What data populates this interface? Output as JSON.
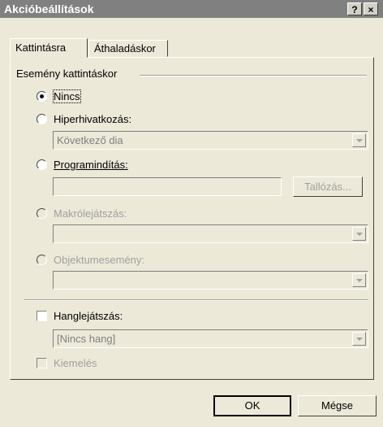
{
  "window": {
    "title": "Akcióbeállítások",
    "help_label": "?",
    "close_label": "×"
  },
  "tabs": [
    {
      "label": "Kattintásra"
    },
    {
      "label": "Áthaladáskor"
    }
  ],
  "group": {
    "label": "Esemény kattintáskor"
  },
  "options": {
    "none": {
      "label": "Nincs"
    },
    "hyperlink": {
      "label": "Hiperhivatkozás:",
      "value": "Következő dia"
    },
    "run_program": {
      "label": "Programindítás:",
      "browse_label": "Tallózás..."
    },
    "run_macro": {
      "label": "Makrólejátszás:"
    },
    "object_action": {
      "label": "Objektumesemény:"
    }
  },
  "sound": {
    "label": "Hanglejátszás:",
    "value": "[Nincs hang]"
  },
  "highlight": {
    "label": "Kiemelés"
  },
  "buttons": {
    "ok": "OK",
    "cancel": "Mégse"
  }
}
